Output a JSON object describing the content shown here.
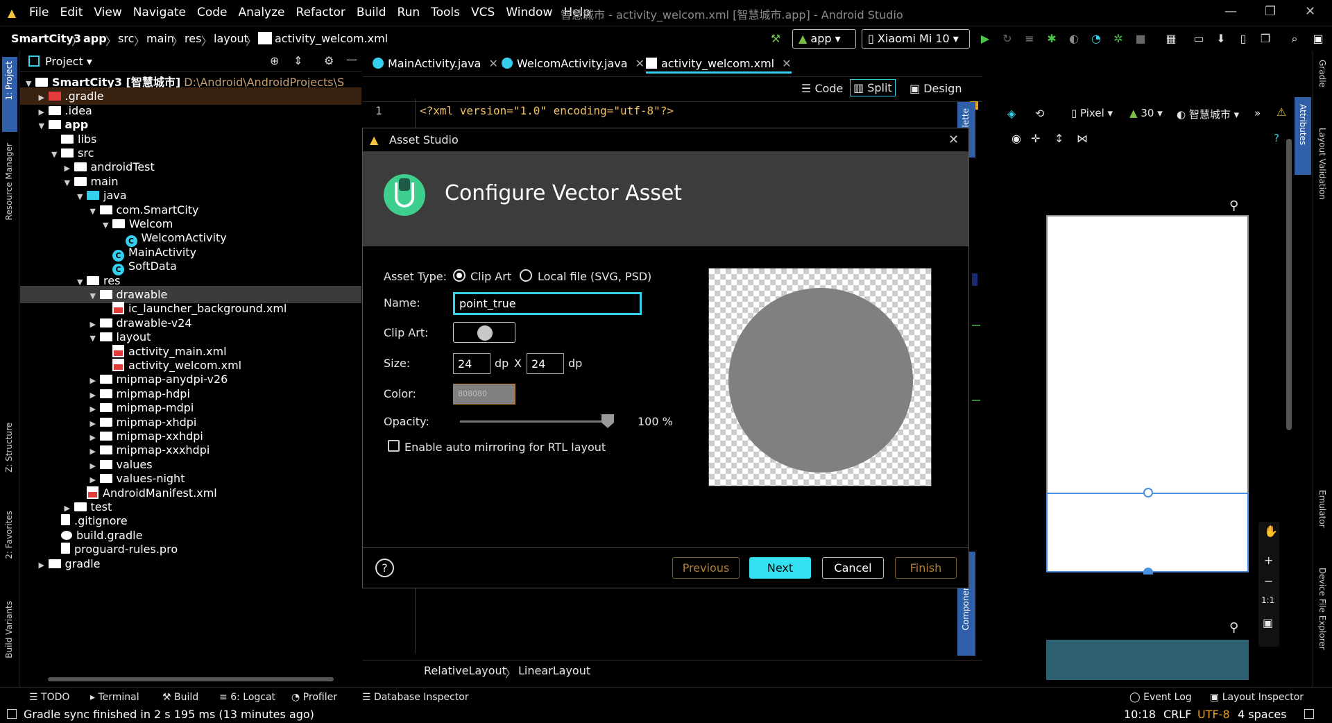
{
  "menubar": {
    "items": [
      "File",
      "Edit",
      "View",
      "Navigate",
      "Code",
      "Analyze",
      "Refactor",
      "Build",
      "Run",
      "Tools",
      "VCS",
      "Window",
      "Help"
    ],
    "title": "智慧城市 - activity_welcom.xml [智慧城市.app] - Android Studio"
  },
  "navbar": {
    "crumbs": [
      "SmartCity3",
      "app",
      "src",
      "main",
      "res",
      "layout",
      "activity_welcom.xml"
    ],
    "config": "app",
    "device": "Xiaomi Mi 10"
  },
  "left_tabs": [
    "1: Project",
    "Resource Manager",
    "Z: Structure",
    "2: Favorites",
    "Build Variants"
  ],
  "right_tabs": [
    "Gradle",
    "Layout Validation",
    "Emulator",
    "Device File Explorer"
  ],
  "project": {
    "title": "Project",
    "tree": [
      {
        "label": "SmartCity3 [智慧城市]",
        "path": "D:\\Android\\AndroidProjects\\S",
        "level": 0,
        "open": true,
        "icon": "folder"
      },
      {
        "label": ".gradle",
        "level": 1,
        "open": false,
        "icon": "folder-red",
        "highlight": true
      },
      {
        "label": ".idea",
        "level": 1,
        "open": false,
        "icon": "folder"
      },
      {
        "label": "app",
        "level": 1,
        "open": true,
        "icon": "folder"
      },
      {
        "label": "libs",
        "level": 2,
        "icon": "folder"
      },
      {
        "label": "src",
        "level": 2,
        "open": true,
        "icon": "folder"
      },
      {
        "label": "androidTest",
        "level": 3,
        "open": false,
        "icon": "folder"
      },
      {
        "label": "main",
        "level": 3,
        "open": true,
        "icon": "folder"
      },
      {
        "label": "java",
        "level": 4,
        "open": true,
        "icon": "folder-cyan"
      },
      {
        "label": "com.SmartCity",
        "level": 5,
        "open": true,
        "icon": "package"
      },
      {
        "label": "Welcom",
        "level": 6,
        "open": true,
        "icon": "package"
      },
      {
        "label": "WelcomActivity",
        "level": 7,
        "icon": "class"
      },
      {
        "label": "MainActivity",
        "level": 6,
        "icon": "class"
      },
      {
        "label": "SoftData",
        "level": 6,
        "icon": "class"
      },
      {
        "label": "res",
        "level": 4,
        "open": true,
        "icon": "folder"
      },
      {
        "label": "drawable",
        "level": 5,
        "open": true,
        "icon": "folder",
        "selected": true
      },
      {
        "label": "ic_launcher_background.xml",
        "level": 6,
        "icon": "xml"
      },
      {
        "label": "drawable-v24",
        "level": 5,
        "open": false,
        "icon": "folder"
      },
      {
        "label": "layout",
        "level": 5,
        "open": true,
        "icon": "folder"
      },
      {
        "label": "activity_main.xml",
        "level": 6,
        "icon": "xml"
      },
      {
        "label": "activity_welcom.xml",
        "level": 6,
        "icon": "xml"
      },
      {
        "label": "mipmap-anydpi-v26",
        "level": 5,
        "open": false,
        "icon": "folder"
      },
      {
        "label": "mipmap-hdpi",
        "level": 5,
        "open": false,
        "icon": "folder"
      },
      {
        "label": "mipmap-mdpi",
        "level": 5,
        "open": false,
        "icon": "folder"
      },
      {
        "label": "mipmap-xhdpi",
        "level": 5,
        "open": false,
        "icon": "folder"
      },
      {
        "label": "mipmap-xxhdpi",
        "level": 5,
        "open": false,
        "icon": "folder"
      },
      {
        "label": "mipmap-xxxhdpi",
        "level": 5,
        "open": false,
        "icon": "folder"
      },
      {
        "label": "values",
        "level": 5,
        "open": false,
        "icon": "folder"
      },
      {
        "label": "values-night",
        "level": 5,
        "open": false,
        "icon": "folder"
      },
      {
        "label": "AndroidManifest.xml",
        "level": 4,
        "icon": "manifest"
      },
      {
        "label": "test",
        "level": 3,
        "open": false,
        "icon": "folder"
      },
      {
        "label": ".gitignore",
        "level": 2,
        "icon": "file"
      },
      {
        "label": "build.gradle",
        "level": 2,
        "icon": "gradle"
      },
      {
        "label": "proguard-rules.pro",
        "level": 2,
        "icon": "file"
      },
      {
        "label": "gradle",
        "level": 1,
        "open": false,
        "icon": "folder"
      }
    ]
  },
  "editor": {
    "tabs": [
      "MainActivity.java",
      "WelcomActivity.java",
      "activity_welcom.xml"
    ],
    "line1": "<?xml version=\"1.0\" encoding=\"utf-8\"?>",
    "line_no": "1",
    "view_modes": [
      "Code",
      "Split",
      "Design"
    ],
    "breadcrumb": [
      "RelativeLayout",
      "LinearLayout"
    ]
  },
  "design": {
    "palette": "Palette",
    "component_tree": "Component Tree",
    "attributes": "Attributes",
    "device": "Pixel",
    "api": "30",
    "theme": "智慧城市"
  },
  "dialog": {
    "window_title": "Asset Studio",
    "heading": "Configure Vector Asset",
    "asset_type_label": "Asset Type:",
    "asset_type_options": [
      "Clip Art",
      "Local file (SVG, PSD)"
    ],
    "name_label": "Name:",
    "name_value": "point_true",
    "clipart_label": "Clip Art:",
    "size_label": "Size:",
    "width": "24",
    "height": "24",
    "unit": "dp",
    "x_sep": "X",
    "color_label": "Color:",
    "color_value": "808080",
    "opacity_label": "Opacity:",
    "opacity_value": "100 %",
    "opacity": 1.0,
    "rtl_label": "Enable auto mirroring for RTL layout",
    "buttons": {
      "previous": "Previous",
      "next": "Next",
      "cancel": "Cancel",
      "finish": "Finish"
    },
    "help": "?"
  },
  "tool_windows": [
    "TODO",
    "Terminal",
    "Build",
    "6: Logcat",
    "Profiler",
    "Database Inspector",
    "Event Log",
    "Layout Inspector"
  ],
  "status": {
    "message": "Gradle sync finished in 2 s 195 ms (13 minutes ago)",
    "position": "10:18",
    "line_sep": "CRLF",
    "encoding": "UTF-8",
    "indent": "4 spaces"
  },
  "colors": {
    "accent": "#35e0f0",
    "preview_fill": "#808080"
  }
}
